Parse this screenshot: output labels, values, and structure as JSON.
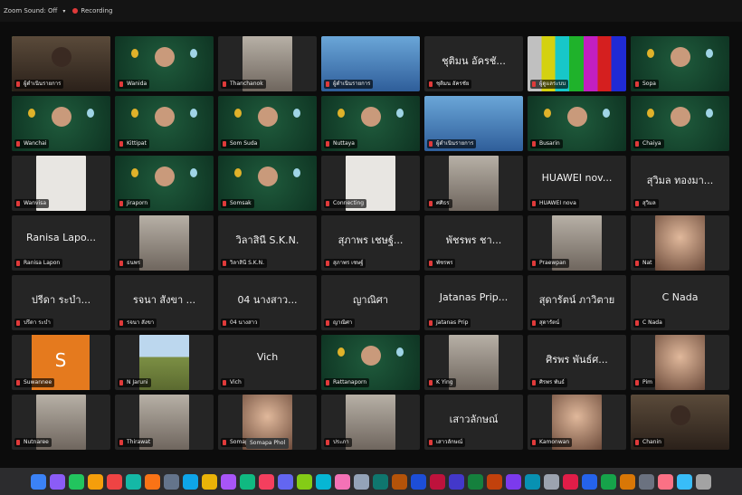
{
  "topbar": {
    "source": "Zoom Sound: Off",
    "dropdown": "▾",
    "recording": "Recording"
  },
  "tooltip": "Somapa Phol",
  "tiles": [
    {
      "bg": "room",
      "name": "ผู้ดำเนินรายการ",
      "big": "",
      "active": true
    },
    {
      "bg": "green",
      "name": "Wanida",
      "big": ""
    },
    {
      "bg": "photo",
      "name": "Thanchanok",
      "big": ""
    },
    {
      "bg": "blue",
      "name": "ผู้ดำเนินรายการ",
      "big": ""
    },
    {
      "bg": "none",
      "name": "ชุติมน อัครชัย",
      "big": "ชุติมน อัครชั..."
    },
    {
      "bg": "bars",
      "name": "ผู้ดูแลระบบ",
      "big": ""
    },
    {
      "bg": "green",
      "name": "Sopa",
      "big": ""
    },
    {
      "bg": "green",
      "name": "Wanchai",
      "big": ""
    },
    {
      "bg": "green",
      "name": "Kittipat",
      "big": ""
    },
    {
      "bg": "green",
      "name": "Som Suda",
      "big": ""
    },
    {
      "bg": "green",
      "name": "Nuttaya",
      "big": ""
    },
    {
      "bg": "blue",
      "name": "ผู้ดำเนินรายการ",
      "big": ""
    },
    {
      "bg": "green",
      "name": "Busarin",
      "big": ""
    },
    {
      "bg": "green",
      "name": "Chaiya",
      "big": ""
    },
    {
      "bg": "white",
      "name": "Wanvisa",
      "big": ""
    },
    {
      "bg": "green",
      "name": "Jiraporn",
      "big": ""
    },
    {
      "bg": "green",
      "name": "Somsak",
      "big": ""
    },
    {
      "bg": "white",
      "name": "Connecting",
      "big": ""
    },
    {
      "bg": "photo",
      "name": "ศศิธร",
      "big": ""
    },
    {
      "bg": "none",
      "name": "HUAWEI nova",
      "big": "HUAWEI nov..."
    },
    {
      "bg": "none",
      "name": "สุวิมล",
      "big": "สุวิมล ทองมา..."
    },
    {
      "bg": "none",
      "name": "Ranisa Lapon",
      "big": "Ranisa Lapo..."
    },
    {
      "bg": "photo",
      "name": "ธนพร",
      "big": ""
    },
    {
      "bg": "none",
      "name": "วิลาสินี S.K.N.",
      "big": "วิลาสินี S.K.N."
    },
    {
      "bg": "none",
      "name": "สุภาพร เชษฐ์",
      "big": "สุภาพร เชษฐ์..."
    },
    {
      "bg": "none",
      "name": "พัชรพร",
      "big": "พัชรพร ชา..."
    },
    {
      "bg": "photo",
      "name": "Praewpan",
      "big": ""
    },
    {
      "bg": "face",
      "name": "Nat",
      "big": ""
    },
    {
      "bg": "none",
      "name": "ปรีดา ระบำ",
      "big": "ปรีดา ระบำ..."
    },
    {
      "bg": "none",
      "name": "รจนา สังขา",
      "big": "รจนา สังขา ..."
    },
    {
      "bg": "none",
      "name": "04 นางสาว",
      "big": "04 นางสาว..."
    },
    {
      "bg": "none",
      "name": "ญาณิศา",
      "big": "ญาณิศา"
    },
    {
      "bg": "none",
      "name": "Jatanas Prip",
      "big": "Jatanas Prip..."
    },
    {
      "bg": "none",
      "name": "สุดารัตน์",
      "big": "สุดารัตน์ ภาวิตาย"
    },
    {
      "bg": "none",
      "name": "C Nada",
      "big": "C  Nada"
    },
    {
      "bg": "letter",
      "letter": "S",
      "name": "Suwannee",
      "big": ""
    },
    {
      "bg": "land",
      "name": "N Jaruni",
      "big": ""
    },
    {
      "bg": "none",
      "name": "Vich",
      "big": "Vich"
    },
    {
      "bg": "green",
      "name": "Rattanaporn",
      "big": ""
    },
    {
      "bg": "photo",
      "name": "K Ying",
      "big": ""
    },
    {
      "bg": "none",
      "name": "ศิรพร พันธ์",
      "big": "ศิรพร พันธ์ศ..."
    },
    {
      "bg": "face",
      "name": "Pim",
      "big": ""
    },
    {
      "bg": "photo",
      "name": "Nutnaree",
      "big": ""
    },
    {
      "bg": "photo",
      "name": "Thirawat",
      "big": ""
    },
    {
      "bg": "face",
      "name": "Somapa",
      "big": ""
    },
    {
      "bg": "photo",
      "name": "ประภา",
      "big": ""
    },
    {
      "bg": "none",
      "name": "เสาวลักษณ์",
      "big": "เสาวลักษณ์"
    },
    {
      "bg": "face",
      "name": "Kamonwan",
      "big": ""
    },
    {
      "bg": "room",
      "name": "Chanin",
      "big": ""
    }
  ],
  "dock": [
    "#3b82f6",
    "#8b5cf6",
    "#22c55e",
    "#f59e0b",
    "#ef4444",
    "#14b8a6",
    "#f97316",
    "#64748b",
    "#0ea5e9",
    "#eab308",
    "#a855f7",
    "#10b981",
    "#f43f5e",
    "#6366f1",
    "#84cc16",
    "#06b6d4",
    "#f472b6",
    "#94a3b8",
    "#0f766e",
    "#b45309",
    "#1d4ed8",
    "#be123c",
    "#4338ca",
    "#15803d",
    "#c2410c",
    "#7c3aed",
    "#0891b2",
    "#9ca3af",
    "#e11d48",
    "#2563eb",
    "#16a34a",
    "#d97706",
    "#6b7280",
    "#fb7185",
    "#38bdf8",
    "#a3a3a3"
  ]
}
